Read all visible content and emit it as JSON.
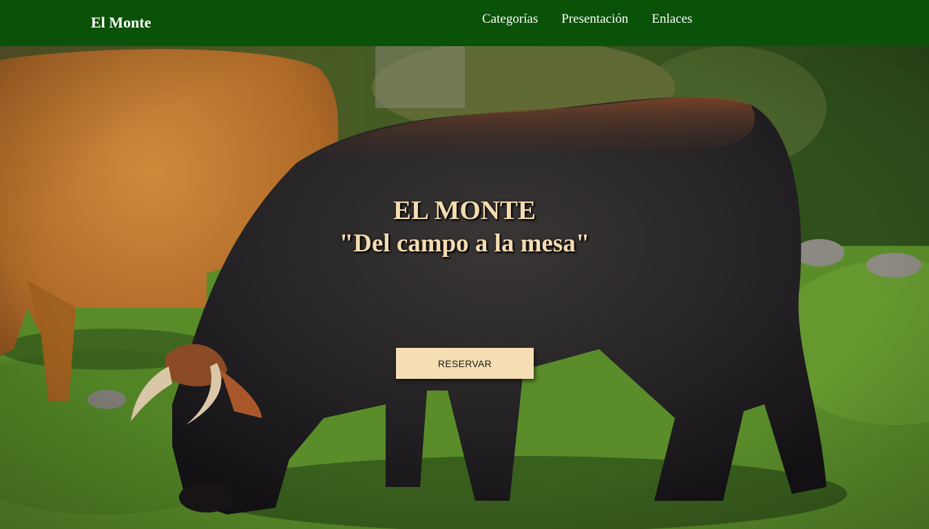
{
  "navbar": {
    "brand": "El Monte",
    "links": [
      {
        "label": "Categorías"
      },
      {
        "label": "Presentación"
      },
      {
        "label": "Enlaces"
      }
    ],
    "background_color": "#0b5209"
  },
  "hero": {
    "title": "EL MONTE",
    "subtitle": "\"Del campo a la mesa\"",
    "cta_label": "RESERVAR",
    "text_color": "#f3dcb0",
    "cta_color": "#f5deb3"
  }
}
